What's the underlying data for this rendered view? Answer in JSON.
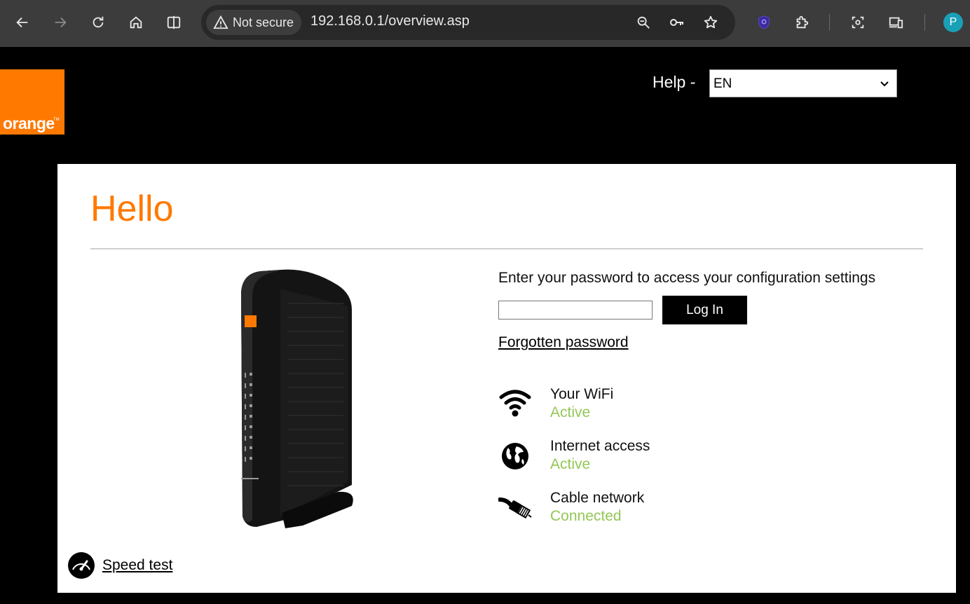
{
  "browser": {
    "security_label": "Not secure",
    "url": "192.168.0.1/overview.asp",
    "profile_initial": "P",
    "icons": [
      "back-icon",
      "forward-icon",
      "reload-icon",
      "home-icon",
      "split-view-icon",
      "warning-icon",
      "zoom-icon",
      "password-key-icon",
      "bookmark-star-icon",
      "shield-extension-icon",
      "extensions-puzzle-icon",
      "screenshot-icon",
      "devices-icon"
    ]
  },
  "header": {
    "logo_text": "orange",
    "logo_tm": "TM",
    "help_label": "Help -",
    "language_selected": "EN"
  },
  "main": {
    "greeting": "Hello",
    "instruction": "Enter your password to access your configuration settings",
    "password_value": "",
    "login_label": "Log In",
    "forgot_label": "Forgotten password",
    "status": [
      {
        "label": "Your WiFi",
        "value": "Active",
        "icon": "wifi-icon"
      },
      {
        "label": "Internet access",
        "value": "Active",
        "icon": "globe-icon"
      },
      {
        "label": "Cable network",
        "value": "Connected",
        "icon": "coax-cable-icon"
      }
    ],
    "speed_test_label": "Speed test"
  },
  "colors": {
    "brand_orange": "#ff7900",
    "status_green": "#93c755",
    "background": "#000000",
    "panel": "#ffffff"
  }
}
